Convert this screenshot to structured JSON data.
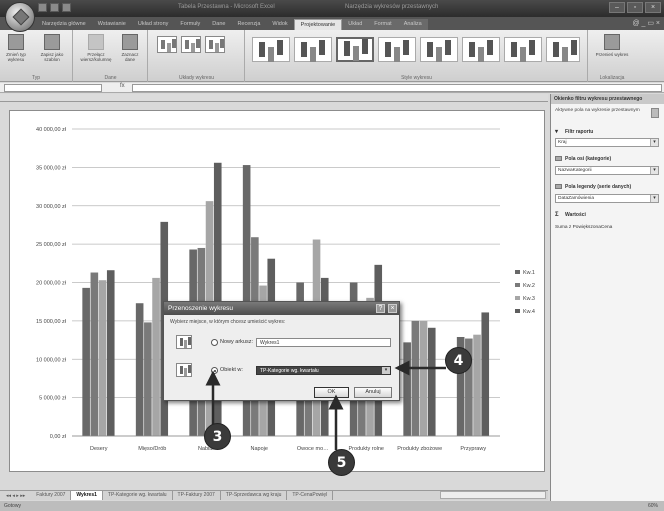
{
  "window": {
    "title_file": "Tabela Przestawna - Microsoft Excel",
    "title_context": "Narzędzia wykresów przestawnych",
    "controls": [
      "–",
      "▫",
      "×"
    ]
  },
  "ribbon": {
    "tabs": [
      {
        "label": "Narzędzia główne",
        "active": false,
        "ctx": false
      },
      {
        "label": "Wstawianie",
        "active": false,
        "ctx": false
      },
      {
        "label": "Układ strony",
        "active": false,
        "ctx": false
      },
      {
        "label": "Formuły",
        "active": false,
        "ctx": false
      },
      {
        "label": "Dane",
        "active": false,
        "ctx": false
      },
      {
        "label": "Recenzja",
        "active": false,
        "ctx": false
      },
      {
        "label": "Widok",
        "active": false,
        "ctx": false
      },
      {
        "label": "Projektowanie",
        "active": true,
        "ctx": true
      },
      {
        "label": "Układ",
        "active": false,
        "ctx": true
      },
      {
        "label": "Format",
        "active": false,
        "ctx": true
      },
      {
        "label": "Analiza",
        "active": false,
        "ctx": true
      }
    ],
    "help": "@ _ ▭ ×",
    "groups": {
      "typ": {
        "label": "Typ",
        "change_type": "Zmień typ wykresu",
        "save_template": "Zapisz jako szablon"
      },
      "dane": {
        "label": "Dane",
        "switch": "Przełącz wiersz/kolumnę",
        "select_data": "Zaznacz dane"
      },
      "uklady": {
        "label": "Układy wykresu"
      },
      "style": {
        "label": "Style wykresu"
      },
      "lokalizacja": {
        "label": "Lokalizacja",
        "move_chart": "Przenieś wykres"
      }
    }
  },
  "formula_bar": {
    "fx": "fx"
  },
  "chart_data": {
    "type": "bar",
    "categories": [
      "Desery",
      "Mięso/Drób",
      "Nabiał",
      "Napoje",
      "Owoce mo…",
      "Produkty rolne",
      "Produkty zbożowe",
      "Przyprawy"
    ],
    "series": [
      {
        "name": "Kw.1",
        "color": "#686868",
        "values": [
          19300,
          17300,
          24300,
          35300,
          20000,
          20000,
          12200,
          12900
        ]
      },
      {
        "name": "Kw.2",
        "color": "#7a7a7a",
        "values": [
          21300,
          14800,
          24500,
          25900,
          17000,
          16000,
          15000,
          12700
        ]
      },
      {
        "name": "Kw.3",
        "color": "#a6a6a6",
        "values": [
          20300,
          20600,
          30600,
          19600,
          25600,
          18000,
          15000,
          13200
        ]
      },
      {
        "name": "Kw.4",
        "color": "#5e5e5e",
        "values": [
          21600,
          27900,
          35600,
          23100,
          20600,
          22300,
          14100,
          16100
        ]
      }
    ],
    "yticks": [
      "0,00 zł",
      "5 000,00 zł",
      "10 000,00 zł",
      "15 000,00 zł",
      "20 000,00 zł",
      "25 000,00 zł",
      "30 000,00 zł",
      "35 000,00 zł",
      "40 000,00 zł"
    ],
    "ylim": [
      0,
      40000
    ],
    "grid": true,
    "legend_position": "right"
  },
  "pivot_pane": {
    "title": "Okienko filtru wykresu przestawnego",
    "description": "Aktywne pola na wykresie przestawnym",
    "report_filter": "Filtr raportu",
    "report_filter_value": "Kraj",
    "axis_fields": "Pola osi (kategorie)",
    "axis_value": "NazwaKategorii",
    "legend_fields": "Pola legendy (serie danych)",
    "legend_value": "DataZamówienia",
    "values": "Wartości",
    "values_item": "Suma z PowiększonaCena"
  },
  "sheets": {
    "nav": "◂◂ ◂ ▸ ▸▸",
    "tabs": [
      {
        "label": "Faktury 2007",
        "active": false
      },
      {
        "label": "Wykres1",
        "active": true
      },
      {
        "label": "TP-Kategorie wg. kwartału",
        "active": false
      },
      {
        "label": "TP-Faktury 2007",
        "active": false
      },
      {
        "label": "TP-Sprzedawca wg kraju",
        "active": false
      },
      {
        "label": "TP-CenaPowięl",
        "active": false
      }
    ]
  },
  "status": {
    "ready": "Gotowy",
    "zoom": "60%"
  },
  "dialog": {
    "title": "Przenoszenie wykresu",
    "description": "Wybierz miejsce, w którym chcesz umieścić wykres:",
    "new_sheet_label": "Nowy arkusz:",
    "new_sheet_value": "Wykres1",
    "object_in_label": "Obiekt w:",
    "object_in_value": "TP-Kategorie wg. kwartału",
    "ok": "OK",
    "cancel": "Anuluj",
    "help": "?",
    "close": "×"
  },
  "callouts": {
    "c3": "3",
    "c4": "4",
    "c5": "5"
  }
}
